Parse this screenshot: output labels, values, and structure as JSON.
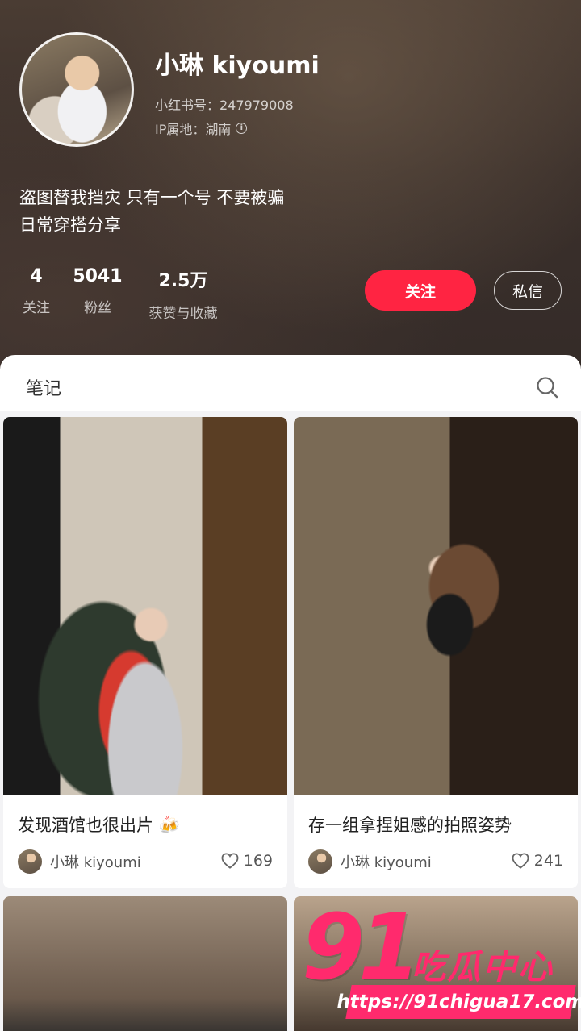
{
  "profile": {
    "name": "小琳 kiyoumi",
    "id_line": "小红书号：247979008",
    "ip_line": "IP属地：湖南",
    "bio": [
      "盗图替我挡灾 只有一个号 不要被骗",
      "日常穿搭分享"
    ],
    "stats": {
      "following": {
        "value": "4",
        "label": "关注"
      },
      "fans": {
        "value": "5041",
        "label": "粉丝"
      },
      "likes": {
        "value": "2.5万",
        "label": "获赞与收藏"
      }
    },
    "follow_label": "关注",
    "message_label": "私信",
    "accent_color": "#ff2442"
  },
  "notes": {
    "tab_label": "笔记",
    "cards": [
      {
        "title": "发现酒馆也很出片 🍻",
        "author": "小琳 kiyoumi",
        "likes": "169"
      },
      {
        "title": "存一组拿捏姐感的拍照姿势",
        "author": "小琳 kiyoumi",
        "likes": "241"
      }
    ]
  },
  "watermark": {
    "number": "91",
    "text": "吃瓜中心",
    "url": "https://91chigua17.com"
  }
}
